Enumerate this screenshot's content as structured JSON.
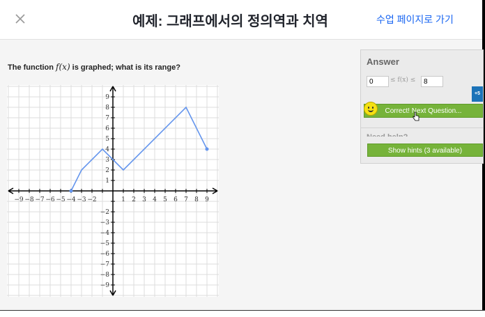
{
  "header": {
    "title": "예제: 그래프에서의 정의역과 치역",
    "back_link": "수업 페이지로 가기"
  },
  "question": {
    "prefix": "The function ",
    "func": "f(x)",
    "suffix": " is graphed; what is its range?"
  },
  "graph": {
    "x_range": [
      -9,
      9
    ],
    "y_range": [
      -9,
      9
    ],
    "x_tick_labels": [
      "−9",
      "−8",
      "−7",
      "−6",
      "−5",
      "−4",
      "−3",
      "−2",
      "1",
      "2",
      "3",
      "4",
      "5",
      "6",
      "7",
      "8",
      "9"
    ],
    "y_tick_labels": [
      "9",
      "8",
      "7",
      "6",
      "5",
      "4",
      "3",
      "2",
      "1",
      "−2",
      "−3",
      "−4",
      "−5",
      "−6",
      "−7",
      "−8",
      "−9"
    ],
    "points": [
      [
        -4,
        0
      ],
      [
        -3,
        2
      ],
      [
        -1,
        4
      ],
      [
        0,
        3
      ],
      [
        1,
        2
      ],
      [
        7,
        8
      ],
      [
        9,
        4
      ]
    ],
    "line_color": "#6495ed",
    "grid": true
  },
  "answer": {
    "title": "Answer",
    "min_value": "0",
    "inequality": "≤ f(x) ≤",
    "max_value": "8",
    "correct_button": "Correct! Next Question...",
    "tab_label": "+5",
    "need_help": "Need help?",
    "hints_button": "Show hints (3 available)"
  },
  "colors": {
    "accent_green": "#76b33a",
    "link_blue": "#1865f2",
    "tab_blue": "#1c73b8"
  }
}
